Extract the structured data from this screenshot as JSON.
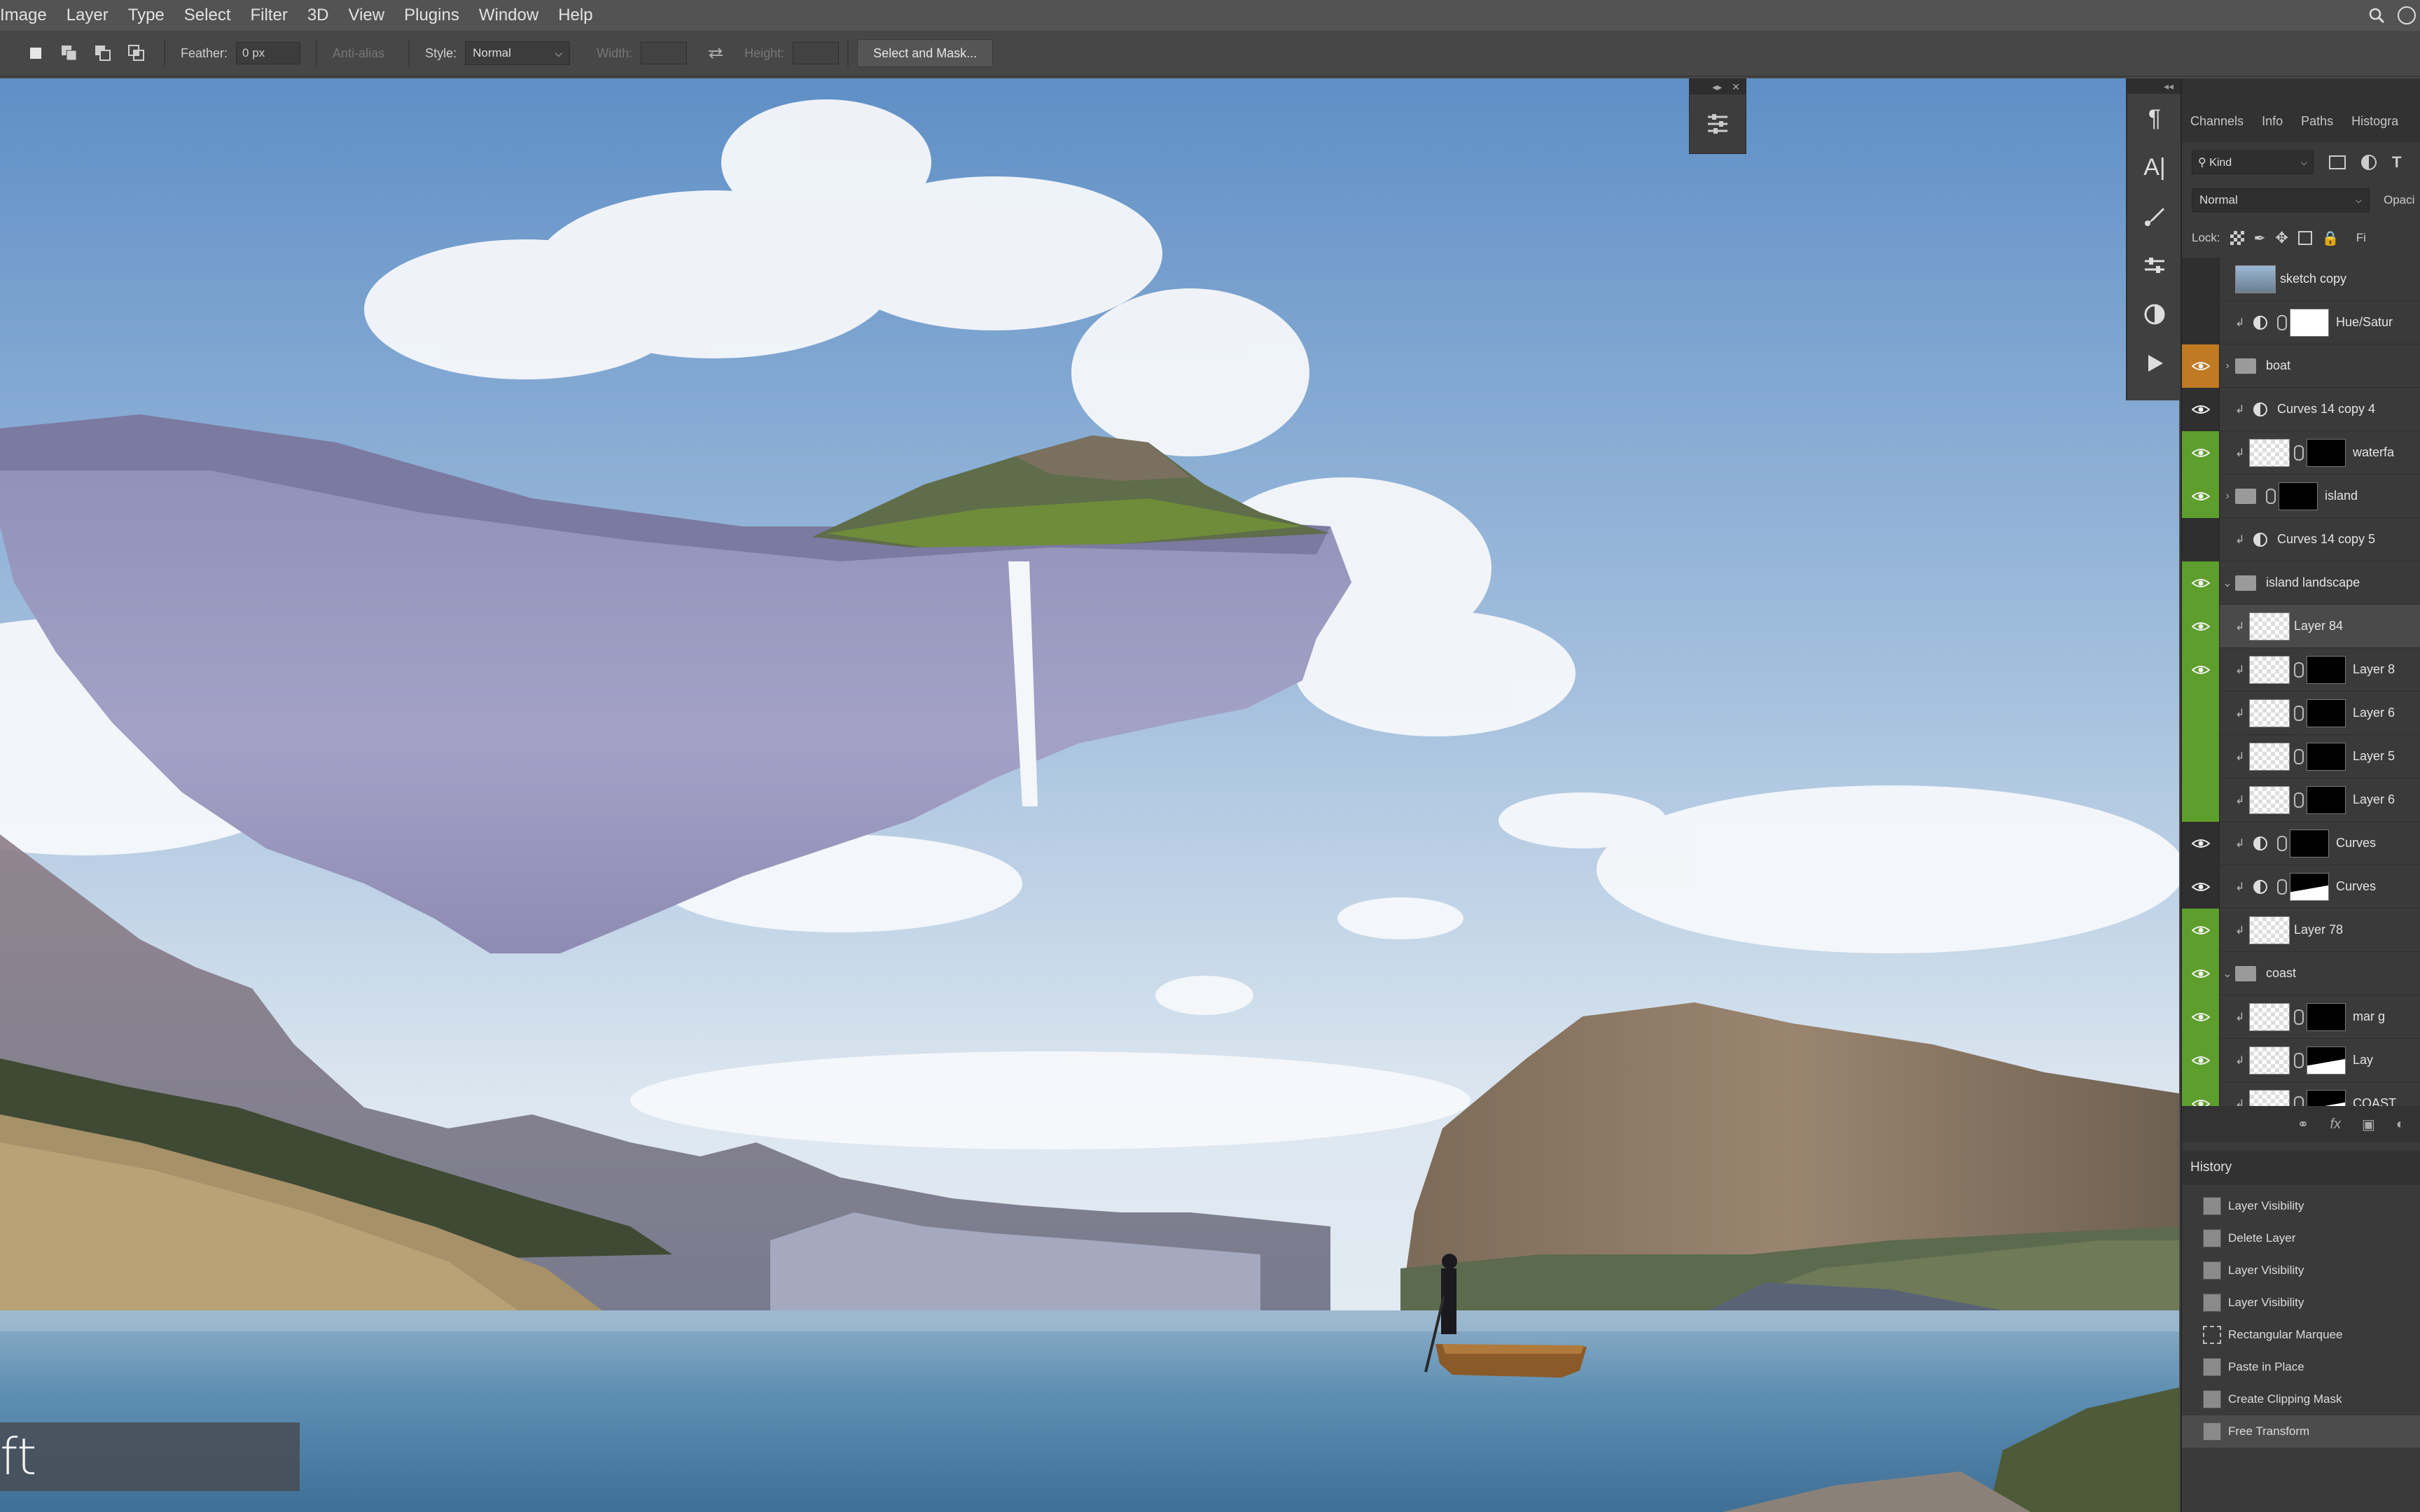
{
  "menubar": {
    "items": [
      "Image",
      "Layer",
      "Type",
      "Select",
      "Filter",
      "3D",
      "View",
      "Plugins",
      "Window",
      "Help"
    ]
  },
  "options": {
    "feather_label": "Feather:",
    "feather_value": "0 px",
    "anti_alias_label": "Anti-alias",
    "style_label": "Style:",
    "style_value": "Normal",
    "width_label": "Width:",
    "height_label": "Height:",
    "select_mask_label": "Select and Mask..."
  },
  "canvas": {
    "caption": "ft"
  },
  "layers_panel": {
    "tabs": [
      "Channels",
      "Info",
      "Paths",
      "Histogra"
    ],
    "filter_kind": "Kind",
    "blend_mode": "Normal",
    "opacity_label": "Opaci",
    "lock_label": "Lock:",
    "fill_label": "Fi",
    "layers": [
      {
        "name": "sketch copy",
        "vis": "none",
        "type": "image"
      },
      {
        "name": "Hue/Satur",
        "vis": "none",
        "type": "adjustment-mask"
      },
      {
        "name": "boat",
        "vis": "orange",
        "type": "group"
      },
      {
        "name": "Curves 14 copy 4",
        "vis": "eye",
        "type": "adjustment"
      },
      {
        "name": "waterfa",
        "vis": "green",
        "type": "smart-mask"
      },
      {
        "name": "island",
        "vis": "green",
        "type": "group-mask"
      },
      {
        "name": "Curves 14 copy 5",
        "vis": "none",
        "type": "adjustment"
      },
      {
        "name": "island landscape",
        "vis": "green",
        "type": "group-open"
      },
      {
        "name": "Layer 84",
        "vis": "green",
        "type": "image-clip"
      },
      {
        "name": "Layer 8",
        "vis": "green",
        "type": "smart-mask"
      },
      {
        "name": "Layer 6",
        "vis": "greenoff",
        "type": "smart-mask"
      },
      {
        "name": "Layer 5",
        "vis": "greenoff",
        "type": "smart-mask"
      },
      {
        "name": "Layer 6",
        "vis": "greenoff",
        "type": "smart-mask"
      },
      {
        "name": "Curves",
        "vis": "eye",
        "type": "adjustment-mask"
      },
      {
        "name": "Curves",
        "vis": "eye",
        "type": "adjustment-mask"
      },
      {
        "name": "Layer 78",
        "vis": "green",
        "type": "image-clip"
      },
      {
        "name": "coast",
        "vis": "green",
        "type": "group-open"
      },
      {
        "name": "mar g",
        "vis": "green",
        "type": "smart-mask"
      },
      {
        "name": "Lay",
        "vis": "green",
        "type": "smart-mask"
      },
      {
        "name": "COAST",
        "vis": "green",
        "type": "smart-mask"
      }
    ]
  },
  "history": {
    "tab": "History",
    "items": [
      "Layer Visibility",
      "Delete Layer",
      "Layer Visibility",
      "Layer Visibility",
      "Rectangular Marquee",
      "Paste in Place",
      "Create Clipping Mask",
      "Free Transform"
    ]
  }
}
